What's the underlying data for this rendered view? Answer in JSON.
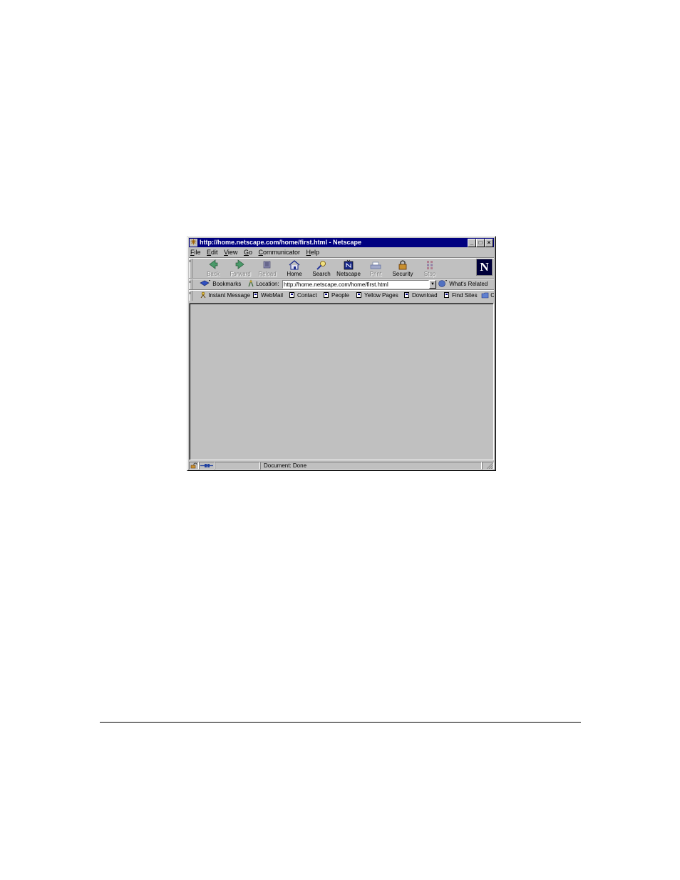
{
  "window": {
    "title": "http://home.netscape.com/home/first.html - Netscape",
    "controls": {
      "minimize": "_",
      "maximize": "□",
      "close": "×"
    }
  },
  "menu": {
    "items": [
      {
        "key": "F",
        "rest": "ile"
      },
      {
        "key": "E",
        "rest": "dit"
      },
      {
        "key": "V",
        "rest": "iew"
      },
      {
        "key": "G",
        "rest": "o"
      },
      {
        "key": "C",
        "rest": "ommunicator"
      },
      {
        "key": "H",
        "rest": "elp"
      }
    ]
  },
  "navigation_toolbar": {
    "buttons": [
      {
        "label": "Back",
        "icon": "back-arrow-icon",
        "enabled": false
      },
      {
        "label": "Forward",
        "icon": "forward-arrow-icon",
        "enabled": false
      },
      {
        "label": "Reload",
        "icon": "reload-icon",
        "enabled": false
      },
      {
        "label": "Home",
        "icon": "home-icon",
        "enabled": true
      },
      {
        "label": "Search",
        "icon": "search-icon",
        "enabled": true
      },
      {
        "label": "Netscape",
        "icon": "netscape-icon",
        "enabled": true
      },
      {
        "label": "Print",
        "icon": "printer-icon",
        "enabled": false
      },
      {
        "label": "Security",
        "icon": "padlock-icon",
        "enabled": true
      },
      {
        "label": "Stop",
        "icon": "stop-icon",
        "enabled": false
      }
    ],
    "logo": "N"
  },
  "location_toolbar": {
    "bookmarks_label": "Bookmarks",
    "location_label": "Location:",
    "url": "http://home.netscape.com/home/first.html",
    "whats_related_label": "What's Related"
  },
  "personal_toolbar": {
    "items": [
      "Instant Message",
      "WebMail",
      "Contact",
      "People",
      "Yellow Pages",
      "Download",
      "Find Sites",
      "C"
    ]
  },
  "status_bar": {
    "text": "Document: Done"
  },
  "colors": {
    "title_bar": "#000080",
    "chrome": "#c0c0c0"
  }
}
